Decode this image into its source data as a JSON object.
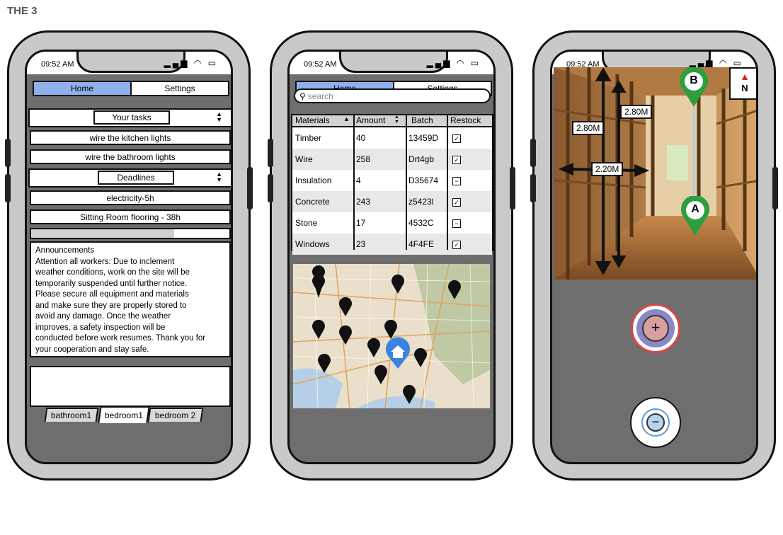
{
  "page_title": "THE 3",
  "status": {
    "time": "09:52 AM"
  },
  "nav": {
    "home": "Home",
    "settings": "Settings"
  },
  "phone1": {
    "tasks_label": "Your tasks",
    "tasks": [
      "wire the kitchen lights",
      "wire the bathroom lights"
    ],
    "deadlines_label": "Deadlines",
    "deadlines": [
      "electricity-5h",
      "Sitting Room flooring - 38h"
    ],
    "progress": 0.72,
    "announcements_title": "Announcements",
    "announcements_lines": [
      "Attention all workers: Due to inclement",
      "weather conditions, work on the site will be",
      "temporarily suspended until further notice.",
      "Please secure all equipment and materials",
      "and make sure they are properly stored to",
      "avoid any damage. Once the weather",
      "improves, a safety inspection will be",
      "conducted before work resumes. Thank you for",
      "your cooperation and stay safe."
    ],
    "room_tabs": [
      "bathroom1",
      "bedroom1",
      "bedroom 2"
    ],
    "active_room": "bedroom1"
  },
  "phone2": {
    "search_placeholder": "search",
    "columns": [
      "Materials",
      "Amount",
      "Batch",
      "Restock"
    ],
    "rows": [
      {
        "material": "Timber",
        "amount": "40",
        "batch": "13459D",
        "restock": "checked"
      },
      {
        "material": "Wire",
        "amount": "258",
        "batch": "Drt4gb",
        "restock": "checked"
      },
      {
        "material": "Insulation",
        "amount": "4",
        "batch": "D35674",
        "restock": "minus"
      },
      {
        "material": "Concrete",
        "amount": "243",
        "batch": "z5423l",
        "restock": "checked"
      },
      {
        "material": "Stone",
        "amount": "17",
        "batch": "4532C",
        "restock": "minus"
      },
      {
        "material": "Windows",
        "amount": "23",
        "batch": "4F4FE",
        "restock": "checked"
      }
    ]
  },
  "phone3": {
    "measurements": [
      "2.80M",
      "2.80M",
      "2.20M"
    ],
    "marker_a": "A",
    "marker_b": "B",
    "compass": "N"
  },
  "colors": {
    "tab_active": "#8fb0ea",
    "pin_green": "#2e9e3f",
    "home_pin": "#3b82e0"
  }
}
